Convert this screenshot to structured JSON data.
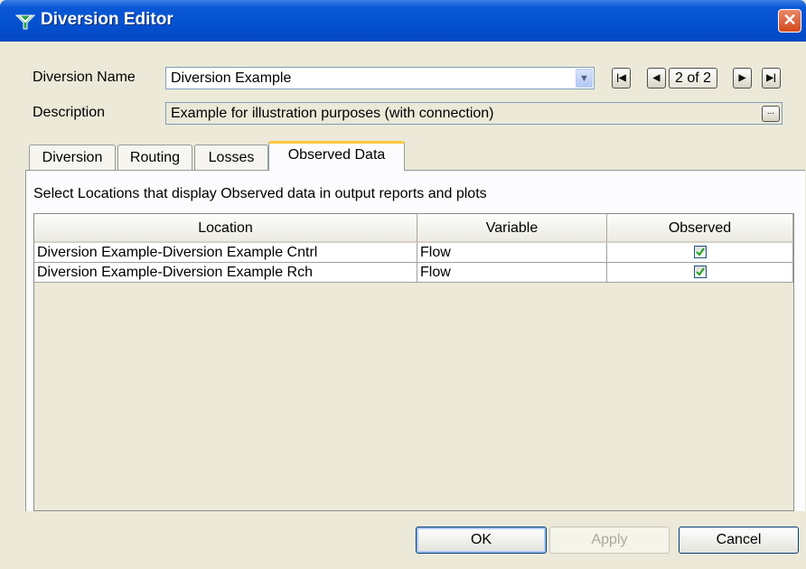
{
  "window": {
    "title": "Diversion Editor"
  },
  "header": {
    "name_label": "Diversion Name",
    "name_value": "Diversion Example",
    "description_label": "Description",
    "description_value": "Example for illustration purposes (with connection)",
    "record_position": "2 of 2"
  },
  "tabs": [
    {
      "label": "Diversion",
      "active": false
    },
    {
      "label": "Routing",
      "active": false
    },
    {
      "label": "Losses",
      "active": false
    },
    {
      "label": "Observed Data",
      "active": true
    }
  ],
  "observed": {
    "instruction": "Select Locations that display Observed data in output reports and plots",
    "columns": [
      "Location",
      "Variable",
      "Observed"
    ],
    "rows": [
      {
        "location": "Diversion Example-Diversion Example Cntrl",
        "variable": "Flow",
        "observed": true
      },
      {
        "location": "Diversion Example-Diversion Example Rch",
        "variable": "Flow",
        "observed": true
      }
    ]
  },
  "buttons": {
    "ok": "OK",
    "apply": "Apply",
    "cancel": "Cancel"
  },
  "icons": {
    "app": "diversion-app-icon",
    "close": "close-icon",
    "first": "first-record-icon",
    "prev": "previous-record-icon",
    "next": "next-record-icon",
    "last": "last-record-icon",
    "dropdown": "chevron-down-icon",
    "ellipsis": "ellipsis-icon",
    "check": "check-icon"
  },
  "colors": {
    "titlebar": "#0451d0",
    "active_tab_accent": "#ffc83c",
    "checkmark": "#21a121"
  }
}
